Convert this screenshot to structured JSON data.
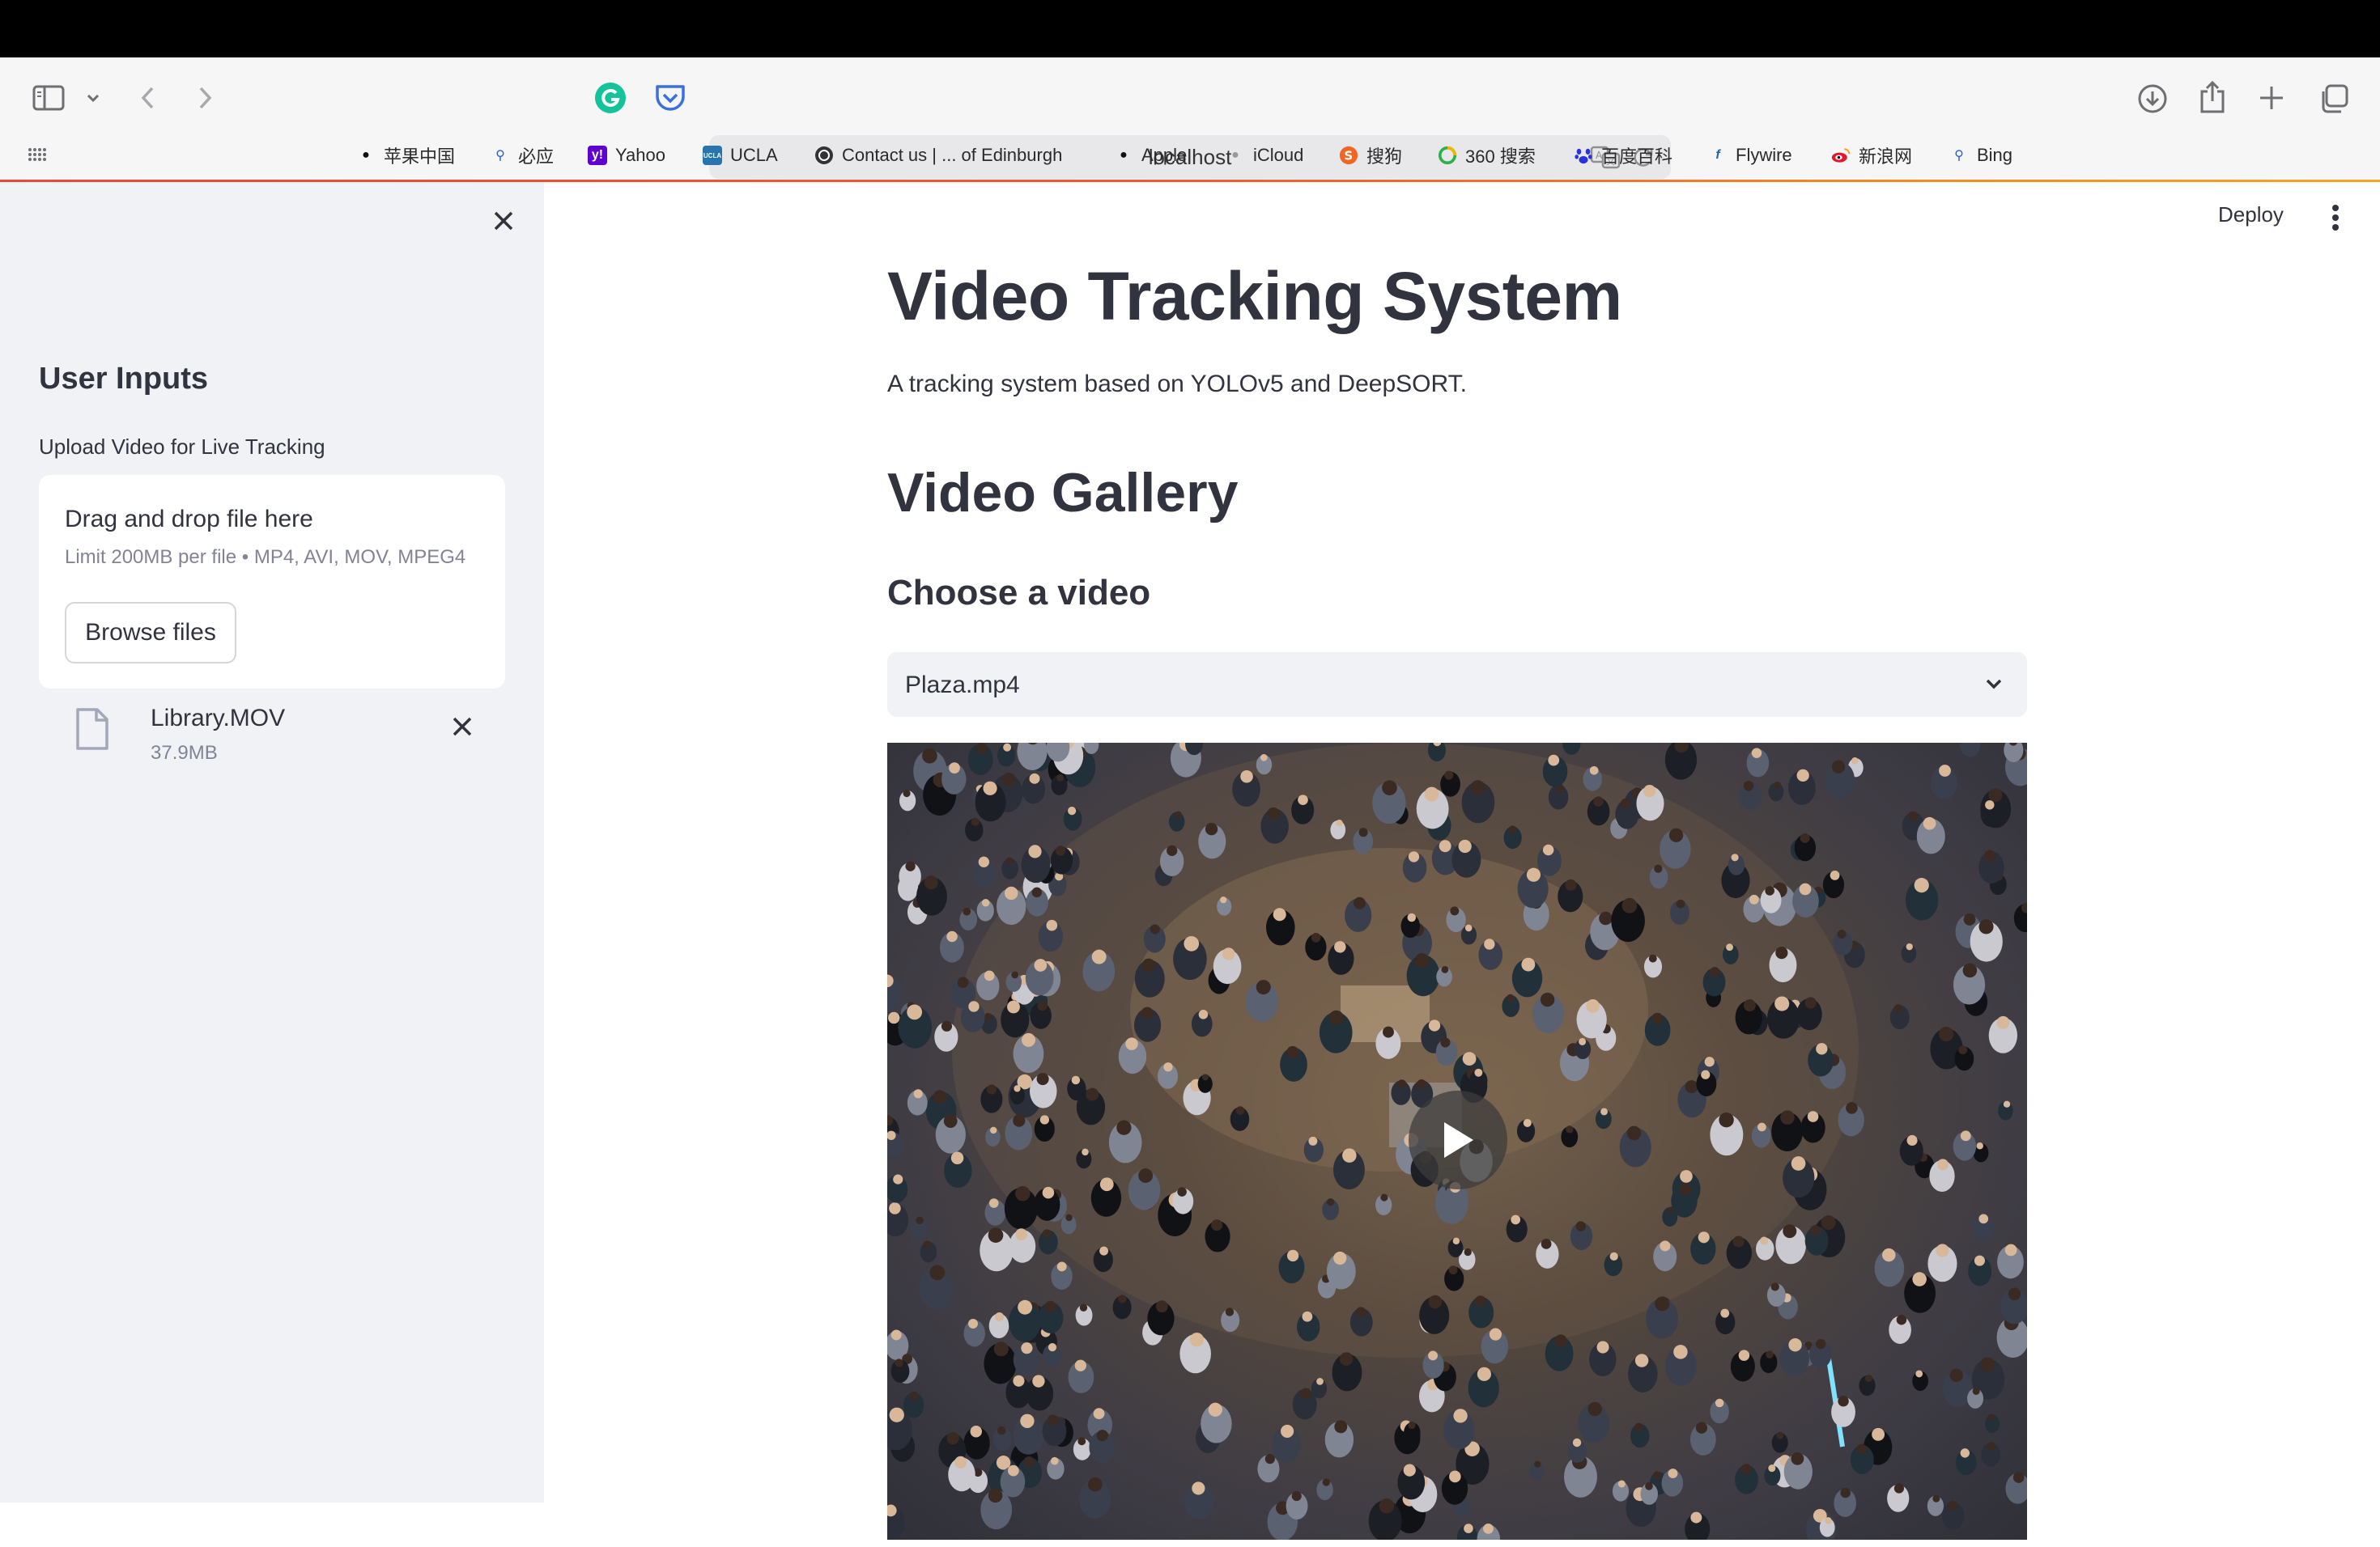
{
  "browser": {
    "url": "localhost",
    "bookmarks": [
      {
        "label": "苹果中国",
        "icon": "apple-icon"
      },
      {
        "label": "必应",
        "icon": "search-icon"
      },
      {
        "label": "Yahoo",
        "icon": "yahoo-icon"
      },
      {
        "label": "UCLA",
        "icon": "ucla-icon"
      },
      {
        "label": "Contact us | ... of Edinburgh",
        "icon": "edinburgh-crest-icon"
      },
      {
        "label": "Apple",
        "icon": "apple-icon"
      },
      {
        "label": "iCloud",
        "icon": "apple-icon"
      },
      {
        "label": "搜狗",
        "icon": "sogou-icon"
      },
      {
        "label": "360 搜索",
        "icon": "360-search-icon"
      },
      {
        "label": "百度百科",
        "icon": "baidu-paw-icon"
      },
      {
        "label": "Flywire",
        "icon": "flywire-icon"
      },
      {
        "label": "新浪网",
        "icon": "weibo-icon"
      },
      {
        "label": "Bing",
        "icon": "search-icon"
      }
    ]
  },
  "sidebar": {
    "heading": "User Inputs",
    "upload_label": "Upload Video for Live Tracking",
    "dropzone_title": "Drag and drop file here",
    "dropzone_limit": "Limit 200MB per file • MP4, AVI, MOV, MPEG4",
    "browse_label": "Browse files",
    "uploaded_file": {
      "name": "Library.MOV",
      "size": "37.9MB"
    }
  },
  "header": {
    "deploy_label": "Deploy"
  },
  "main": {
    "title": "Video Tracking System",
    "description": "A tracking system based on YOLOv5 and DeepSORT.",
    "gallery_title": "Video Gallery",
    "choose_label": "Choose a video",
    "selected_video": "Plaza.mp4"
  },
  "colors": {
    "sidebar_bg": "#f0f2f6",
    "text": "#31333f",
    "muted": "#808495",
    "progress_accent": "#e9473a"
  }
}
